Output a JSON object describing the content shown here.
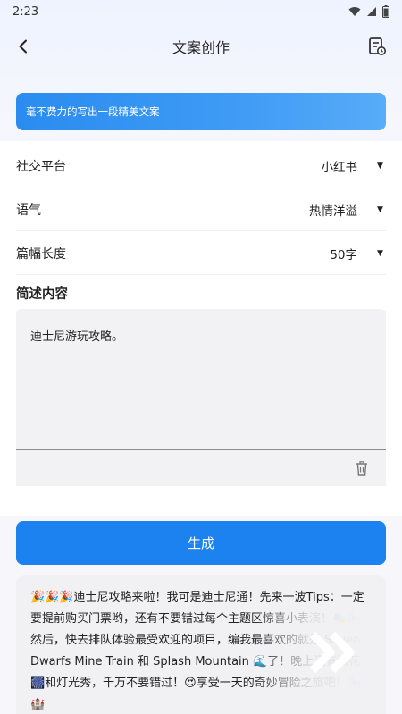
{
  "status_bar": {
    "time": "2:23",
    "icons": [
      "wifi-icon",
      "signal-icon",
      "battery-icon"
    ]
  },
  "app_bar": {
    "title": "文案创作",
    "back_icon": "chevron-left-icon",
    "history_icon": "history-document-icon"
  },
  "banner": {
    "text": "毫不费力的写出一段精美文案"
  },
  "form": {
    "rows": [
      {
        "label": "社交平台",
        "value": "小红书"
      },
      {
        "label": "语气",
        "value": "热情洋溢"
      },
      {
        "label": "篇幅长度",
        "value": "50字"
      }
    ],
    "summary_title": "简述内容",
    "summary_value": "迪士尼游玩攻略。",
    "trash_icon": "trash-icon"
  },
  "generate_button": {
    "label": "生成"
  },
  "result": {
    "text": "🎉🎉🎉迪士尼攻略来啦！我可是迪士尼通！先来一波Tips：一定要提前购买门票哟，还有不要错过每个主题区惊喜小表演！🎭🎠 然后，快去排队体验最受欢迎的项目，编我最喜欢的就是 Seven Dwarfs Mine Train 和 Splash Mountain 🌊了！晚上还有烟花🎆和灯光秀，千万不要错过！😍享受一天的奇妙冒险之旅吧！🎠🏰"
  },
  "colors": {
    "accent": "#1c82f0",
    "banner_start": "#2a8cf0",
    "banner_end": "#58acf8"
  }
}
